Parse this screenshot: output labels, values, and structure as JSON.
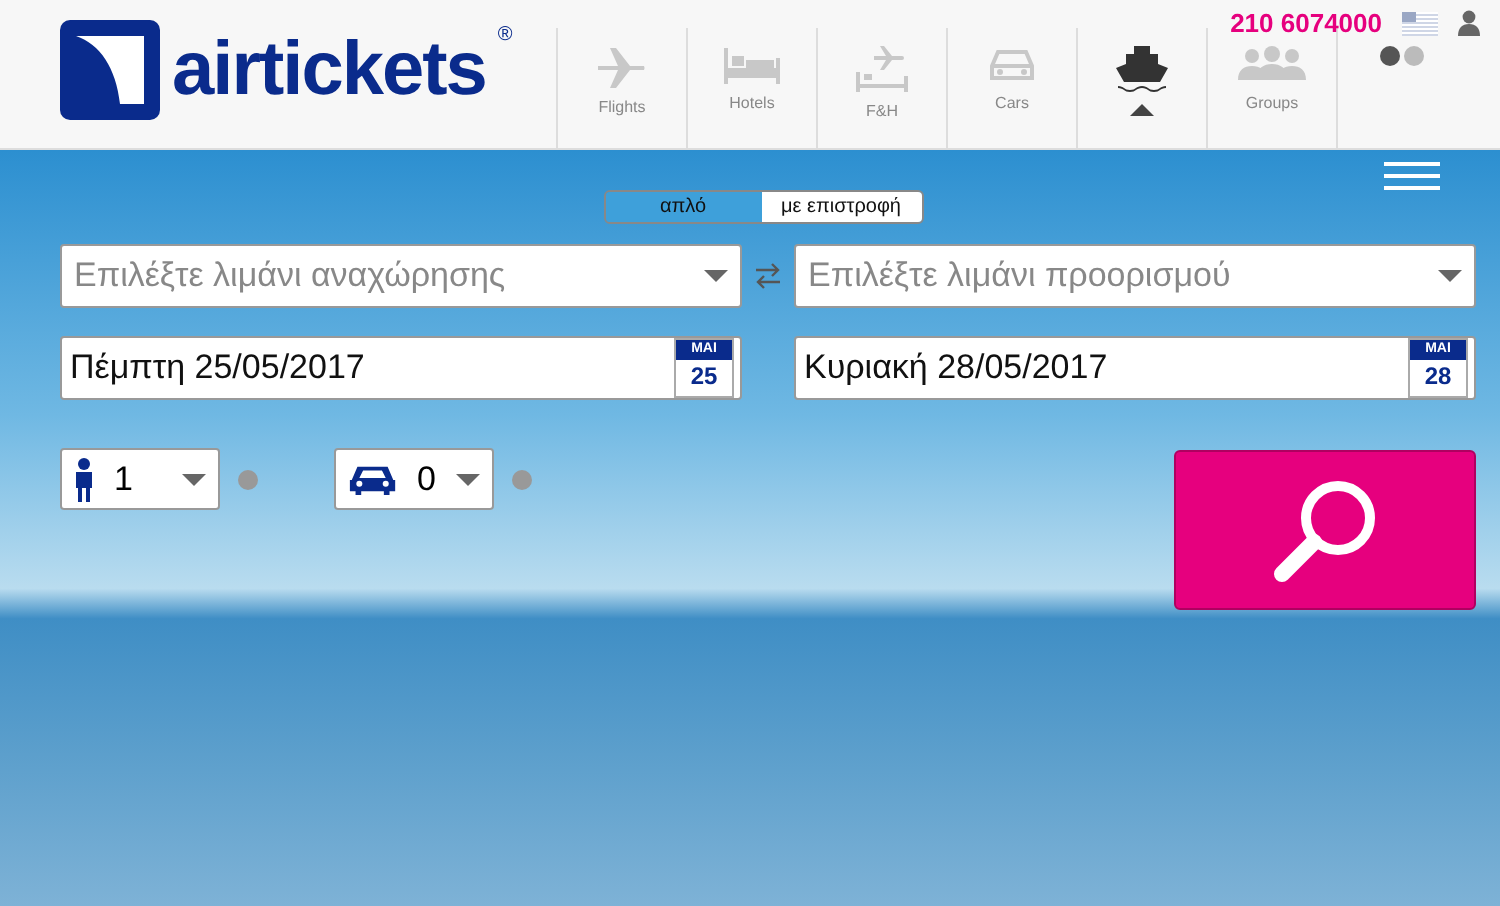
{
  "header": {
    "logo": "airtickets",
    "logo_mark": "®",
    "phone": "210 6074000"
  },
  "nav": [
    {
      "kind": "plane",
      "label": "Flights",
      "selected": false
    },
    {
      "kind": "bed",
      "label": "Hotels",
      "selected": false
    },
    {
      "kind": "fh",
      "label": "F&H",
      "selected": false
    },
    {
      "kind": "car",
      "label": "Cars",
      "selected": false
    },
    {
      "kind": "ship",
      "selected": true
    },
    {
      "kind": "group",
      "label": "Groups",
      "selected": false
    },
    {
      "kind": "dots",
      "selected": false
    }
  ],
  "trip_type": [
    {
      "label": "απλό",
      "selected": false
    },
    {
      "label": "με επιστροφή",
      "selected": true
    }
  ],
  "ports": {
    "departure_placeholder": "Επιλέξτε λιμάνι αναχώρησης",
    "arrival_placeholder": "Επιλέξτε λιμάνι προορισμού"
  },
  "dates": [
    {
      "value": "Πέμπτη 25/05/2017",
      "month": "ΜΑΙ",
      "day": "25"
    },
    {
      "value": "Κυριακή 28/05/2017",
      "month": "ΜΑΙ",
      "day": "28"
    }
  ],
  "counters": [
    {
      "kind": "passenger",
      "value": "1"
    },
    {
      "kind": "vehicle",
      "value": "0"
    }
  ]
}
